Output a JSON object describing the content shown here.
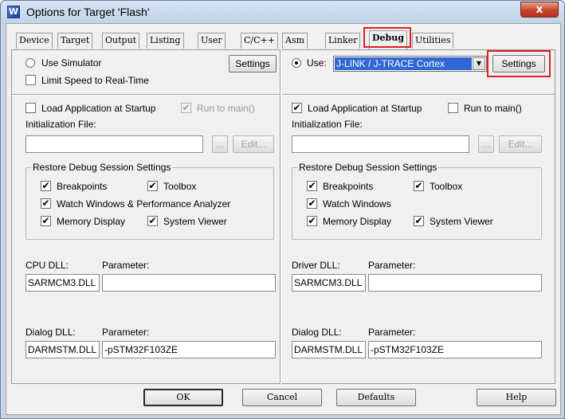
{
  "window": {
    "title": "Options for Target 'Flash'",
    "close_glyph": "x",
    "app_icon_glyph": "W"
  },
  "tabs": [
    {
      "label": "Device"
    },
    {
      "label": "Target"
    },
    {
      "label": "Output"
    },
    {
      "label": "Listing"
    },
    {
      "label": "User"
    },
    {
      "label": "C/C++"
    },
    {
      "label": "Asm"
    },
    {
      "label": "Linker"
    },
    {
      "label": "Debug",
      "active": true
    },
    {
      "label": "Utilities"
    }
  ],
  "left": {
    "use_simulator_label": "Use Simulator",
    "use_simulator_checked": false,
    "settings_label": "Settings",
    "limit_speed_label": "Limit Speed to Real-Time",
    "limit_speed_checked": false,
    "load_app_label": "Load Application at Startup",
    "load_app_checked": false,
    "run_to_main_label": "Run to main()",
    "run_to_main_checked": true,
    "init_file_label": "Initialization File:",
    "init_file_value": "",
    "browse_label": "...",
    "edit_label": "Edit...",
    "restore_group_title": "Restore Debug Session Settings",
    "breakpoints_label": "Breakpoints",
    "toolbox_label": "Toolbox",
    "watch_label": "Watch Windows & Performance Analyzer",
    "memory_label": "Memory Display",
    "system_viewer_label": "System Viewer",
    "cpu_dll_label": "CPU DLL:",
    "cpu_param_label": "Parameter:",
    "cpu_dll_value": "SARMCM3.DLL",
    "cpu_param_value": "",
    "dialog_dll_label": "Dialog DLL:",
    "dialog_param_label": "Parameter:",
    "dialog_dll_value": "DARMSTM.DLL",
    "dialog_param_value": "-pSTM32F103ZE"
  },
  "right": {
    "use_label": "Use:",
    "use_checked": true,
    "debugger_value": "J-LINK / J-TRACE Cortex",
    "settings_label": "Settings",
    "load_app_label": "Load Application at Startup",
    "load_app_checked": true,
    "run_to_main_label": "Run to main()",
    "run_to_main_checked": false,
    "init_file_label": "Initialization File:",
    "init_file_value": "",
    "browse_label": "...",
    "edit_label": "Edit...",
    "restore_group_title": "Restore Debug Session Settings",
    "breakpoints_label": "Breakpoints",
    "toolbox_label": "Toolbox",
    "watch_label": "Watch Windows",
    "memory_label": "Memory Display",
    "system_viewer_label": "System Viewer",
    "driver_dll_label": "Driver DLL:",
    "driver_param_label": "Parameter:",
    "driver_dll_value": "SARMCM3.DLL",
    "driver_param_value": "",
    "dialog_dll_label": "Dialog DLL:",
    "dialog_param_label": "Parameter:",
    "dialog_dll_value": "DARMSTM.DLL",
    "dialog_param_value": "-pSTM32F103ZE"
  },
  "footer": {
    "ok_label": "OK",
    "cancel_label": "Cancel",
    "defaults_label": "Defaults",
    "help_label": "Help"
  },
  "check_glyph": "✔"
}
